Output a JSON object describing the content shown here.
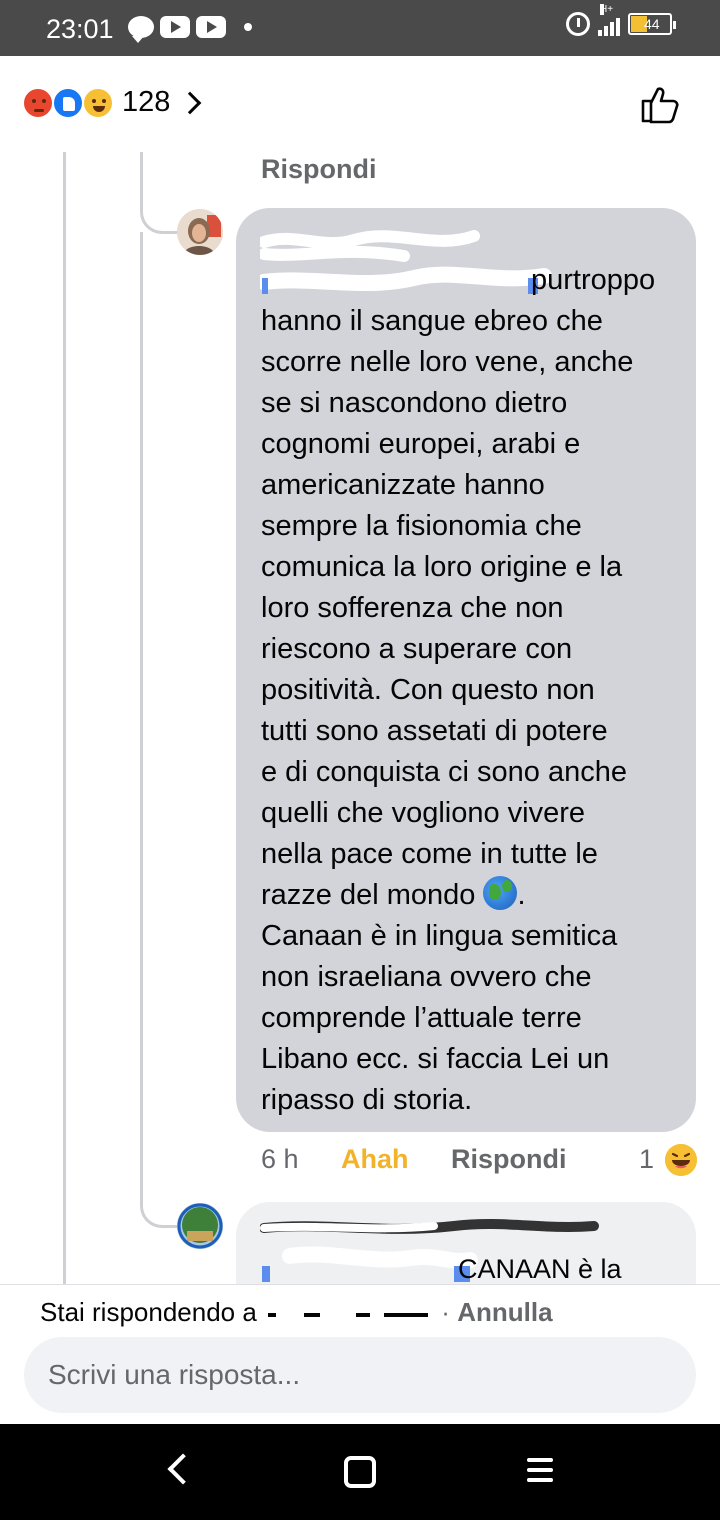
{
  "status_bar": {
    "time": "23:01",
    "network": "H+",
    "battery_level": "44",
    "icons": [
      "chat-icon",
      "youtube-icon",
      "youtube-icon",
      "dot-icon",
      "alarm-icon",
      "signal-icon",
      "battery-icon"
    ]
  },
  "header": {
    "reaction_types": [
      "angry",
      "like",
      "haha"
    ],
    "reaction_count": "128",
    "like_icon": "thumbs-up-outline-icon"
  },
  "thread": {
    "top_reply_label": "Rispondi",
    "comment": {
      "author_redacted": true,
      "text_first_line": "purtroppo",
      "text_body": "hanno il sangue ebreo che\nscorre nelle loro vene, anche\nse si nascondono dietro\ncognomi europei, arabi e\namericanizzate hanno\nsempre la fisionomia che\ncomunica la loro origine e la\nloro sofferenza che non\nriescono a superare con\npositività. Con questo non\ntutti sono assetati di potere\ne di conquista ci sono anche\nquelli che vogliono vivere\nnella pace come in tutte le\nrazze del mondo",
      "text_after_emoji": ".\nCanaan è in lingua semitica\nnon israeliana ovvero che\ncomprende l’attuale terre\nLibano ecc. si faccia Lei un\nripasso di storia.",
      "time": "6 h",
      "reaction_label": "Ahah",
      "reply_label": "Rispondi",
      "reaction_count": "1"
    },
    "next_comment": {
      "text_partial": "CANAAN è la"
    }
  },
  "reply_bar": {
    "replying_to_prefix": "Stai rispondendo a",
    "separator": "·",
    "cancel_label": "Annulla",
    "input_placeholder": "Scrivi una risposta..."
  },
  "colors": {
    "status_bar_bg": "#4a4a4a",
    "bubble_bg": "#d2d4d9",
    "secondary_text": "#65676b",
    "haha_accent": "#f0b32a",
    "like_blue": "#1877f2",
    "angry_red": "#e8462f"
  }
}
